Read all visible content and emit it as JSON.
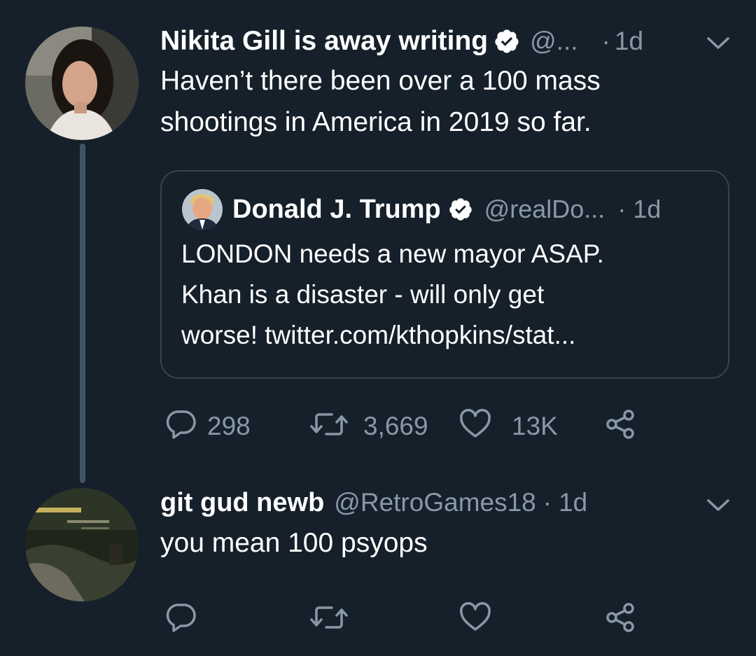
{
  "colors": {
    "background": "#15202b",
    "text": "#ffffff",
    "muted": "#8899a6",
    "border": "#38444d",
    "thread_line": "#3d5466"
  },
  "main_tweet": {
    "author_name": "Nikita Gill is away writing",
    "handle": "@...",
    "separator": "·",
    "time": "1d",
    "text_lines": [
      "Haven’t there been over a 100 mass",
      "shootings in America in 2019 so far."
    ],
    "quoted_tweet": {
      "author_name": "Donald J. Trump",
      "handle": "@realDo...",
      "separator": "·",
      "time": "1d",
      "text_lines": [
        "LONDON needs a new mayor ASAP.",
        "Khan is a disaster - will only get",
        "worse! twitter.com/kthopkins/stat..."
      ]
    },
    "actions": {
      "reply_count": "298",
      "retweet_count": "3,669",
      "like_count": "13K"
    },
    "icons": [
      "verified-badge-icon",
      "chevron-down-icon",
      "reply-icon",
      "retweet-icon",
      "like-icon",
      "share-icon"
    ]
  },
  "reply_tweet": {
    "author_name": "git gud newb",
    "handle": "@RetroGames18",
    "separator": "·",
    "time": "1d",
    "text": "you mean 100 psyops",
    "icons": [
      "chevron-down-icon",
      "reply-icon",
      "retweet-icon",
      "like-icon",
      "share-icon"
    ]
  }
}
